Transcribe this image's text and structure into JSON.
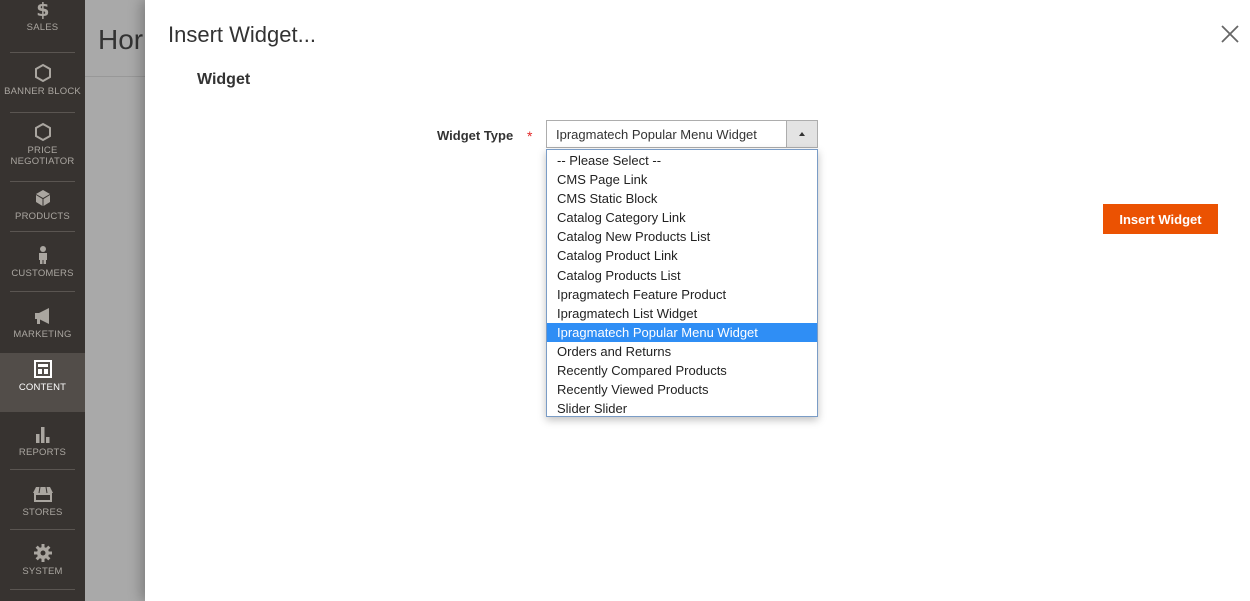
{
  "sidebar": {
    "items": [
      {
        "label": "SALES",
        "icon": "dollar-icon"
      },
      {
        "label": "BANNER BLOCK",
        "icon": "hexagon-icon"
      },
      {
        "label": "PRICE\nNEGOTIATOR",
        "icon": "hexagon-icon"
      },
      {
        "label": "PRODUCTS",
        "icon": "box-icon"
      },
      {
        "label": "CUSTOMERS",
        "icon": "person-icon"
      },
      {
        "label": "MARKETING",
        "icon": "megaphone-icon"
      },
      {
        "label": "CONTENT",
        "icon": "layout-icon"
      },
      {
        "label": "REPORTS",
        "icon": "bar-chart-icon"
      },
      {
        "label": "STORES",
        "icon": "storefront-icon"
      },
      {
        "label": "SYSTEM",
        "icon": "gear-icon"
      }
    ],
    "active_item": "CONTENT"
  },
  "page": {
    "title_fragment": "Hor"
  },
  "modal": {
    "title": "Insert Widget...",
    "close_icon": "close-icon",
    "section_title": "Widget",
    "widget_type": {
      "label": "Widget Type",
      "required_mark": "*",
      "selected_value": "Ipragmatech Popular Menu Widget",
      "options": [
        "-- Please Select --",
        "CMS Page Link",
        "CMS Static Block",
        "Catalog Category Link",
        "Catalog New Products List",
        "Catalog Product Link",
        "Catalog Products List",
        "Ipragmatech Feature Product",
        "Ipragmatech List Widget",
        "Ipragmatech Popular Menu Widget",
        "Orders and Returns",
        "Recently Compared Products",
        "Recently Viewed Products",
        "Slider Slider"
      ],
      "highlighted_index": 9
    },
    "insert_button": "Insert Widget"
  },
  "colors": {
    "sidebar_bg": "#373330",
    "sidebar_active_bg": "#524d49",
    "primary_button": "#eb5202",
    "option_highlight": "#2f8ef5",
    "required": "#e22626"
  }
}
